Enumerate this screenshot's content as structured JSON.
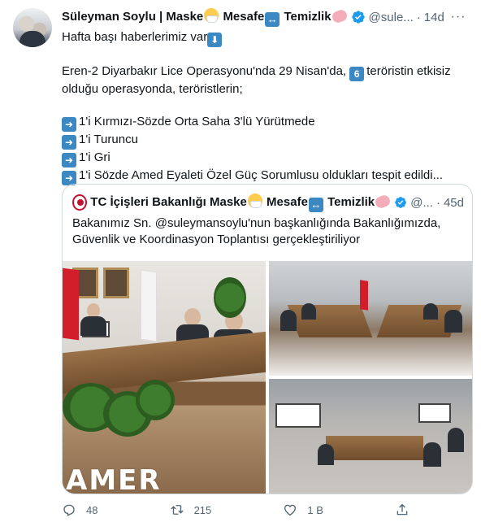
{
  "tweet": {
    "author_name": "Süleyman Soylu | Maske",
    "author_name_mid": "Mesafe",
    "author_name_end": "Temizlik",
    "handle": "@sule...",
    "separator": "·",
    "time": "14d",
    "more_label": "···",
    "body": {
      "line1": "Hafta başı haberlerimiz var",
      "line2": "Eren-2 Diyarbakır Lice Operasyonu'nda 29 Nisan'da,",
      "number_badge": "6",
      "line2_tail": "teröristin etkisiz",
      "line3": "olduğu operasyonda, teröristlerin;",
      "items": [
        "1'i Kırmızı-Sözde Orta Saha 3'lü Yürütmede",
        "1'i Turuncu",
        "1'i Gri",
        "1'i Sözde Amed Eyaleti Özel Güç Sorumlusu oldukları tespit edildi..."
      ]
    },
    "quote": {
      "author_name": "TC İçişleri Bakanlığı Maske",
      "author_name_mid": "Mesafe",
      "author_name_end": "Temizlik",
      "handle": "@...",
      "separator": "·",
      "time": "45d",
      "text_line1": "Bakanımız Sn. @suleymansoylu'nun başkanlığında Bakanlığımızda,",
      "text_line2": "Güvenlik ve Koordinasyon Toplantısı gerçekleştiriliyor",
      "image_text": "AMER"
    },
    "actions": {
      "reply_count": "48",
      "retweet_count": "215",
      "like_count": "1 B",
      "share_label": ""
    },
    "colors": {
      "text": "#0f1419",
      "secondary": "#536471",
      "verified": "#1d9bf0",
      "border": "#cfd9de",
      "emoji_blue": "#3b88c3"
    },
    "icons": [
      "verified-badge-icon",
      "reply-icon",
      "retweet-icon",
      "like-icon",
      "share-icon",
      "more-icon"
    ]
  }
}
